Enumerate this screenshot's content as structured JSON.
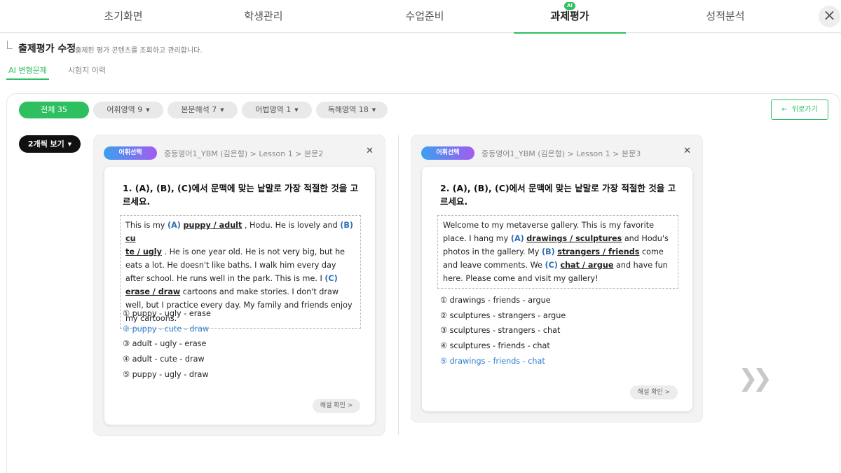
{
  "topnav": {
    "tabs": [
      {
        "label": "초기화면",
        "active": false
      },
      {
        "label": "학생관리",
        "active": false
      },
      {
        "label": "수업준비",
        "active": false
      },
      {
        "label": "과제평가",
        "active": true,
        "badge": "AI"
      },
      {
        "label": "성적분석",
        "active": false
      }
    ],
    "close_icon": "close-icon",
    "accent_color": "#2dbf60"
  },
  "header": {
    "title": "출제평가 수정",
    "description": "출제된 평가 콘텐츠를 조회하고 관리합니다."
  },
  "subtabs": [
    {
      "label": "AI 변형문제",
      "active": true
    },
    {
      "label": "시험지 이력",
      "active": false
    }
  ],
  "filters": [
    {
      "label": "전체 35",
      "active": true
    },
    {
      "label": "어휘영역 9",
      "active": false
    },
    {
      "label": "본문해석 7",
      "active": false
    },
    {
      "label": "어법영역 1",
      "active": false
    },
    {
      "label": "독해영역 18",
      "active": false
    }
  ],
  "back_button": {
    "label": "뒤로가기",
    "icon": "arrow-left-icon"
  },
  "view_button": {
    "label": "2개씩 보기"
  },
  "cards": [
    {
      "tag": "어휘선택",
      "path": "중등영어1_YBM (김은형) > Lesson 1 > 본문2",
      "question": "1. (A), (B), (C)에서 문맥에 맞는 낱말로 가장 적절한 것을 고르세요.",
      "passage": {
        "t1": "This is my ",
        "la": "(A)",
        "wa1": "puppy",
        "sa": " / ",
        "wa2": "adult",
        "t2": " , Hodu. He is lovely and ",
        "lb": "(B)",
        "wb1": "cu",
        "wb1b": "te",
        "sb": " / ",
        "wb2": "ugly",
        "t3": " . He is one year old. He is not very big, but he eats a lot. He doesn't like baths. I walk him every day after school. He runs well in the park. This is me. I ",
        "lc": "(C)",
        "wc1": "erase",
        "sc": " / ",
        "wc2": "draw",
        "t4": " cartoons and make stories. I don't draw well, but I practice every day. My family and friends enjoy my cartoons."
      },
      "options": [
        {
          "label": "① puppy - ugly - erase",
          "correct": false
        },
        {
          "label": "② puppy - cute - draw",
          "correct": true
        },
        {
          "label": "③ adult - ugly - erase",
          "correct": false
        },
        {
          "label": "④ adult - cute - draw",
          "correct": false
        },
        {
          "label": "⑤ puppy - ugly - draw",
          "correct": false
        }
      ],
      "explain_label": "해설 확인 >"
    },
    {
      "tag": "어휘선택",
      "path": "중등영어1_YBM (김은형) > Lesson 1 > 본문3",
      "question": "2. (A), (B), (C)에서 문맥에 맞는 낱말로 가장 적절한 것을 고르세요.",
      "passage": {
        "t1": "Welcome to my metaverse gallery. This is my favorite place. I hang my ",
        "la": "(A)",
        "wa1": "drawings",
        "sa": " / ",
        "wa2": "sculptures",
        "t2": " and Hodu's photos in the gallery. My ",
        "lb": "(B)",
        "wb1": "strangers",
        "sb": " / ",
        "wb2": "friends",
        "t3": " come and leave comments. We ",
        "lc": "(C)",
        "wc1": "chat",
        "sc": " / ",
        "wc2": "argue",
        "t4": " and have fun here. Please come and visit my gallery!"
      },
      "options": [
        {
          "label": "① drawings - friends - argue",
          "correct": false
        },
        {
          "label": "② sculptures - strangers - argue",
          "correct": false
        },
        {
          "label": "③ sculptures - strangers - chat",
          "correct": false
        },
        {
          "label": "④ sculptures - friends - chat",
          "correct": false
        },
        {
          "label": "⑤ drawings - friends - chat",
          "correct": true
        }
      ],
      "explain_label": "해설 확인 >"
    }
  ],
  "next_icon": "double-chevron-right-icon"
}
